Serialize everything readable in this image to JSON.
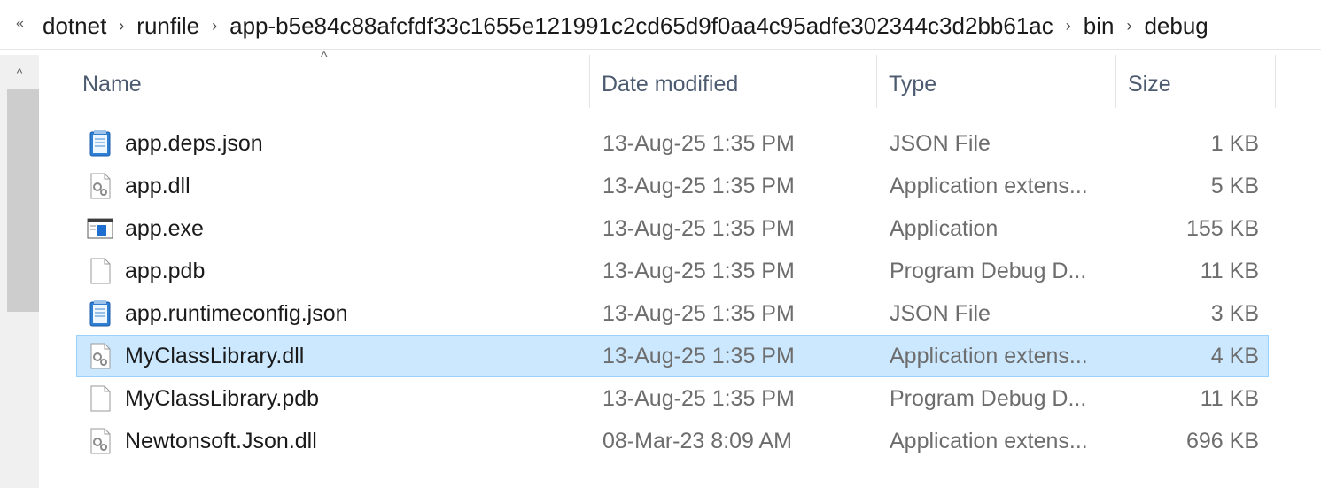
{
  "breadcrumb": {
    "overflow": "«",
    "separator": "›",
    "items": [
      "dotnet",
      "runfile",
      "app-b5e84c88afcfdf33c1655e121991c2cd65d9f0aa4c95adfe302344c3d2bb61ac",
      "bin",
      "debug"
    ]
  },
  "columns": {
    "name": "Name",
    "date": "Date modified",
    "type": "Type",
    "size": "Size",
    "sort_indicator": "^"
  },
  "scroll_up": "^",
  "files": [
    {
      "name": "app.deps.json",
      "date": "13-Aug-25 1:35 PM",
      "type": "JSON File",
      "size": "1 KB",
      "icon": "json-file-icon"
    },
    {
      "name": "app.dll",
      "date": "13-Aug-25 1:35 PM",
      "type": "Application extens...",
      "size": "5 KB",
      "icon": "dll-file-icon"
    },
    {
      "name": "app.exe",
      "date": "13-Aug-25 1:35 PM",
      "type": "Application",
      "size": "155 KB",
      "icon": "exe-file-icon"
    },
    {
      "name": "app.pdb",
      "date": "13-Aug-25 1:35 PM",
      "type": "Program Debug D...",
      "size": "11 KB",
      "icon": "blank-file-icon"
    },
    {
      "name": "app.runtimeconfig.json",
      "date": "13-Aug-25 1:35 PM",
      "type": "JSON File",
      "size": "3 KB",
      "icon": "json-file-icon"
    },
    {
      "name": "MyClassLibrary.dll",
      "date": "13-Aug-25 1:35 PM",
      "type": "Application extens...",
      "size": "4 KB",
      "icon": "dll-file-icon",
      "selected": true
    },
    {
      "name": "MyClassLibrary.pdb",
      "date": "13-Aug-25 1:35 PM",
      "type": "Program Debug D...",
      "size": "11 KB",
      "icon": "blank-file-icon"
    },
    {
      "name": "Newtonsoft.Json.dll",
      "date": "08-Mar-23 8:09 AM",
      "type": "Application extens...",
      "size": "696 KB",
      "icon": "dll-file-icon"
    }
  ],
  "colors": {
    "selection_bg": "#cce8ff",
    "selection_border": "#99d1ff",
    "header_text": "#4c5b70"
  }
}
